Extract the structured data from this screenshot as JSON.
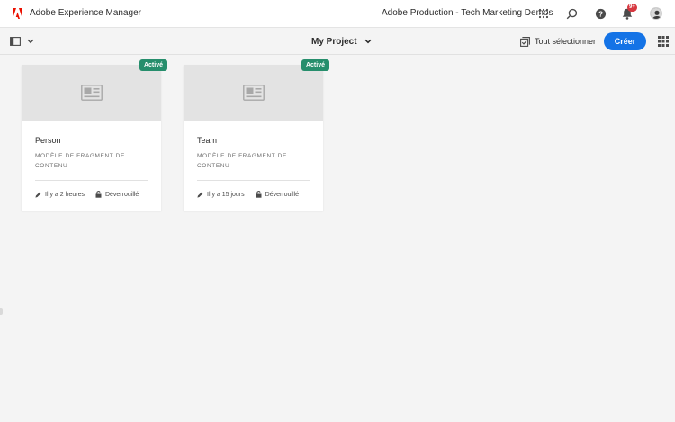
{
  "header": {
    "app_title": "Adobe Experience Manager",
    "org_name": "Adobe Production - Tech Marketing Demos",
    "notification_badge": "9+",
    "icons": [
      "adobe-logo",
      "apps-icon",
      "search-icon",
      "help-icon",
      "bell-icon",
      "user-avatar"
    ],
    "logo_color": "#eb1000"
  },
  "actionbar": {
    "breadcrumb_title": "My Project",
    "select_all_label": "Tout sélectionner",
    "create_label": "Créer",
    "accent_color": "#1473e6"
  },
  "cards": [
    {
      "title": "Person",
      "subtitle": "MODÈLE DE FRAGMENT DE CONTENU",
      "status": "Activé",
      "modified": "Il y a 2 heures",
      "lock_status": "Déverrouillé"
    },
    {
      "title": "Team",
      "subtitle": "MODÈLE DE FRAGMENT DE CONTENU",
      "status": "Activé",
      "modified": "Il y a 15 jours",
      "lock_status": "Déverrouillé"
    }
  ],
  "status_color": "#268e6c"
}
